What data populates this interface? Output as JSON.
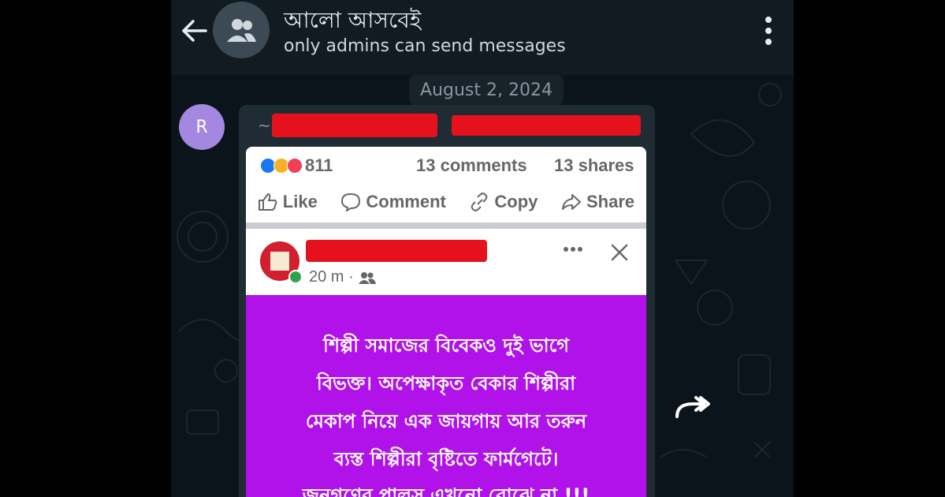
{
  "header": {
    "group_name": "আলো আসবেই",
    "subtitle": "only admins can send messages",
    "back_icon": "arrow-left-icon",
    "avatar_icon": "group-icon",
    "menu_icon": "kebab-menu-icon"
  },
  "chat": {
    "date_label": "August 2, 2024",
    "sender_initial": "R",
    "sender_prefix": "~",
    "forward_icon": "forward-icon"
  },
  "facebook_post": {
    "reaction_count": "811",
    "comments": "13 comments",
    "shares": "13 shares",
    "actions": [
      {
        "label": "Like",
        "icon": "thumbs-up-icon"
      },
      {
        "label": "Comment",
        "icon": "comment-icon"
      },
      {
        "label": "Copy",
        "icon": "link-icon"
      },
      {
        "label": "Share",
        "icon": "share-icon"
      }
    ],
    "post_time": "20 m ·",
    "audience_icon": "friends-icon",
    "body_lines": [
      "শিল্পী সমাজের বিবেকও দুই ভাগে",
      "বিভক্ত। অপেক্ষাকৃত বেকার শিল্পীরা",
      "মেকাপ নিয়ে এক জায়গায় আর তরুন",
      "ব্যস্ত শিল্পীরা বৃষ্টিতে ফার্মগেটে।",
      "জনগণের পালস এখনো বোঝে না !!!"
    ],
    "colors": {
      "background": "#b112ea",
      "redaction": "#e5121e",
      "like_blue": "#1877f2",
      "love_red": "#f33e58",
      "haha_yellow": "#f7b125"
    }
  }
}
